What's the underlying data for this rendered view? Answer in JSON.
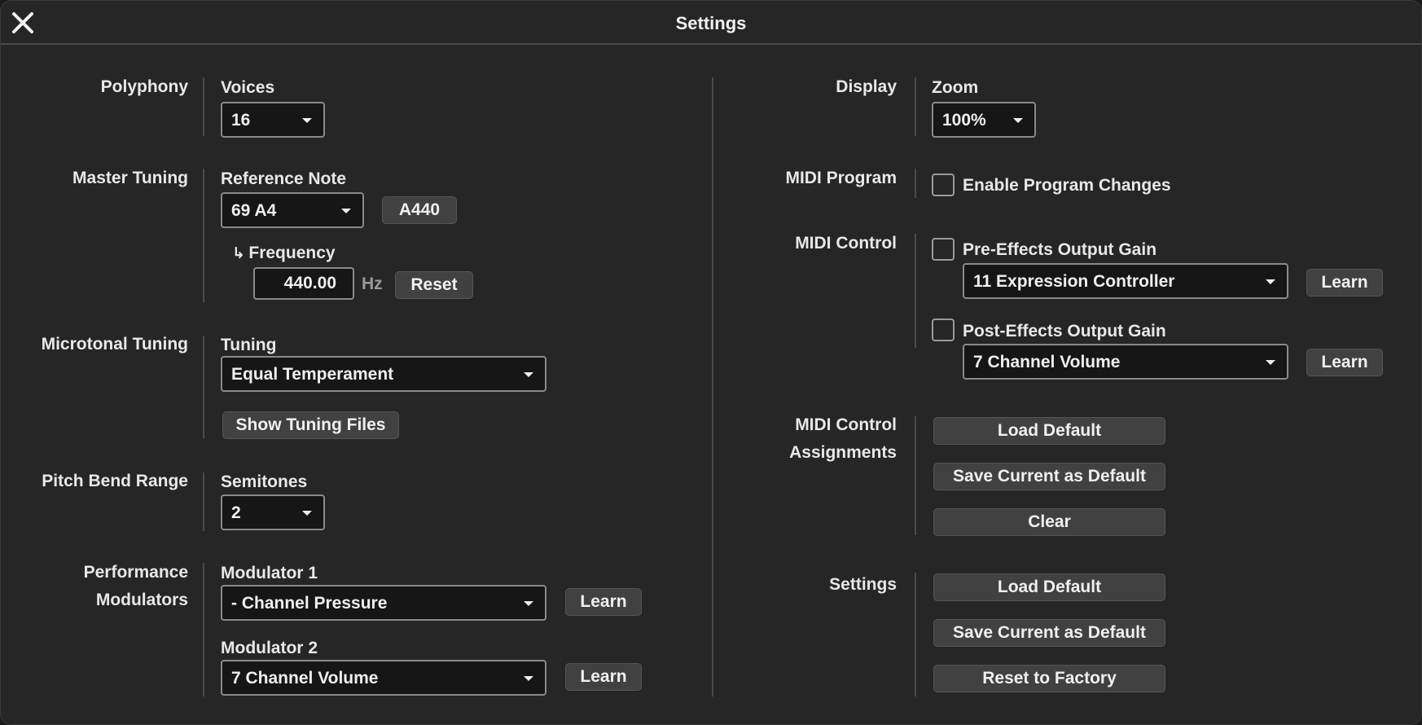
{
  "window": {
    "title": "Settings"
  },
  "polyphony": {
    "label": "Polyphony",
    "field_label": "Voices",
    "value": "16"
  },
  "master_tuning": {
    "label": "Master Tuning",
    "field_label": "Reference Note",
    "value": "69 A4",
    "a440_label": "A440",
    "arrow": "↳",
    "frequency_label": "Frequency",
    "frequency_value": "440.00",
    "unit": "Hz",
    "reset_label": "Reset"
  },
  "microtonal": {
    "label": "Microtonal Tuning",
    "field_label": "Tuning",
    "value": "Equal Temperament",
    "show_files_label": "Show Tuning Files"
  },
  "pitch_bend": {
    "label": "Pitch Bend Range",
    "field_label": "Semitones",
    "value": "2"
  },
  "performance": {
    "label_line1": "Performance",
    "label_line2": "Modulators",
    "mod1_label": "Modulator 1",
    "mod1_value": "- Channel Pressure",
    "mod2_label": "Modulator 2",
    "mod2_value": "7 Channel Volume",
    "learn_label": "Learn"
  },
  "display": {
    "label": "Display",
    "field_label": "Zoom",
    "value": "100%"
  },
  "midi_program": {
    "label": "MIDI Program",
    "checkbox_label": "Enable Program Changes",
    "checked": false
  },
  "midi_control": {
    "label": "MIDI Control",
    "pre_label": "Pre-Effects Output Gain",
    "pre_value": "11 Expression Controller",
    "post_label": "Post-Effects Output Gain",
    "post_value": "7 Channel Volume",
    "learn_label": "Learn"
  },
  "midi_assignments": {
    "label_line1": "MIDI Control",
    "label_line2": "Assignments",
    "load_default": "Load Default",
    "save_default": "Save Current as Default",
    "clear": "Clear"
  },
  "settings_section": {
    "label": "Settings",
    "load_default": "Load Default",
    "save_default": "Save Current as Default",
    "reset_factory": "Reset to Factory"
  }
}
